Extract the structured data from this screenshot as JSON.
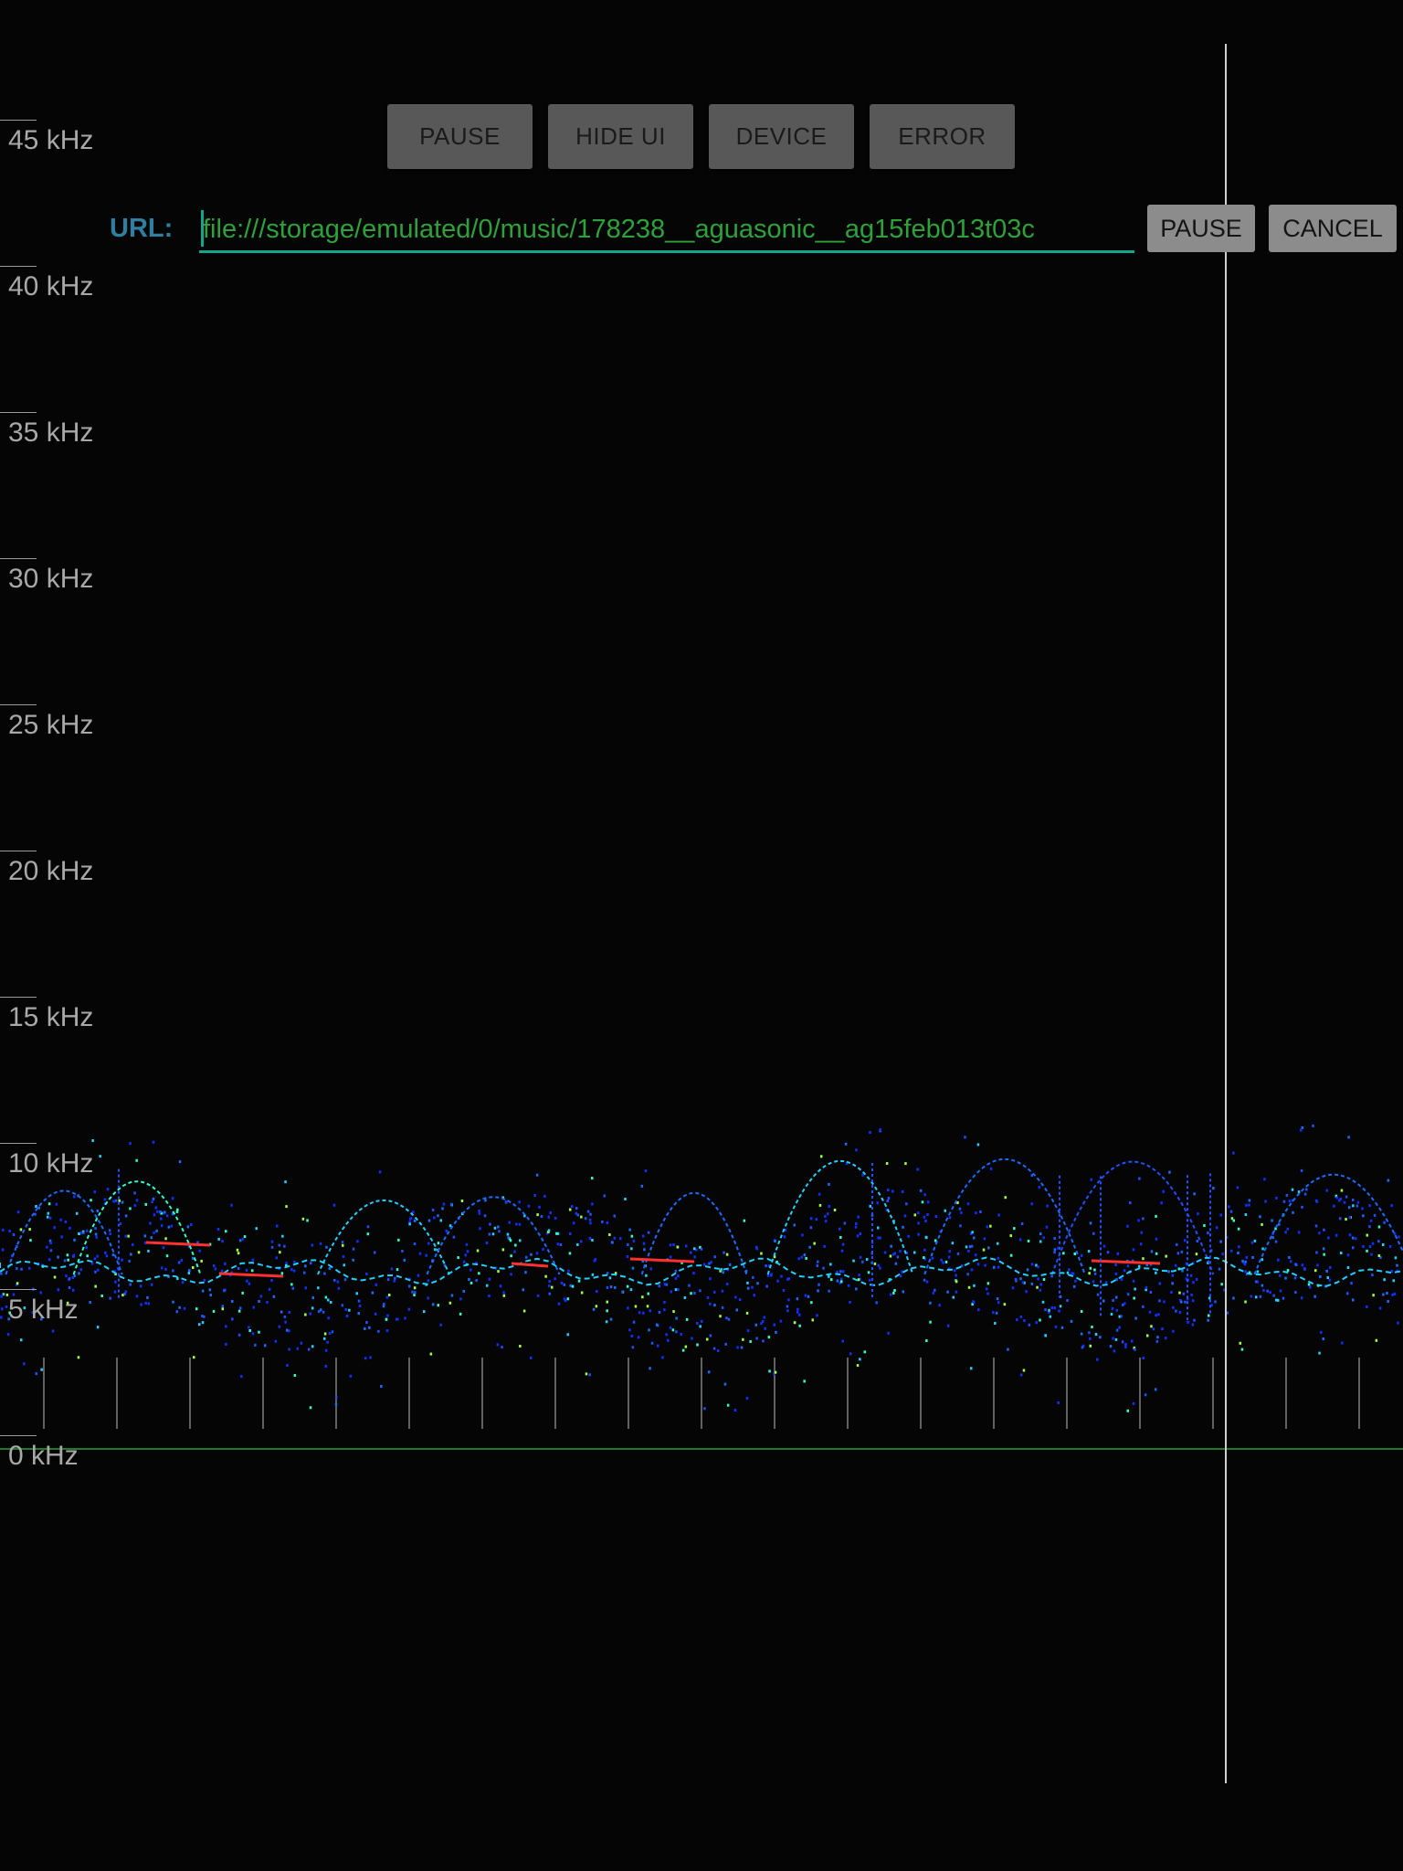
{
  "controls": {
    "pause_label": "PAUSE",
    "hide_ui_label": "HIDE UI",
    "device_label": "DEVICE",
    "error_label": "ERROR"
  },
  "url_bar": {
    "label": "URL:",
    "value": "file:///storage/emulated/0/music/178238__aguasonic__ag15feb013t03c",
    "pause_label": "PAUSE",
    "cancel_label": "CANCEL"
  },
  "frequency_axis": {
    "labels": [
      "45 kHz",
      "40 kHz",
      "35 kHz",
      "30 kHz",
      "25 kHz",
      "20 kHz",
      "15 kHz",
      "10 kHz",
      "5 kHz",
      "0 kHz"
    ]
  },
  "colors": {
    "background": "#050505",
    "playhead": "#cfcfcf",
    "label_text": "#a8a8a8",
    "url_text": "#2ea23a",
    "url_label": "#2f7fa0",
    "url_underline": "#13a58e",
    "spectrum_low": "#1030ff",
    "spectrum_mid": "#20d0ff",
    "spectrum_high": "#ff3030"
  }
}
